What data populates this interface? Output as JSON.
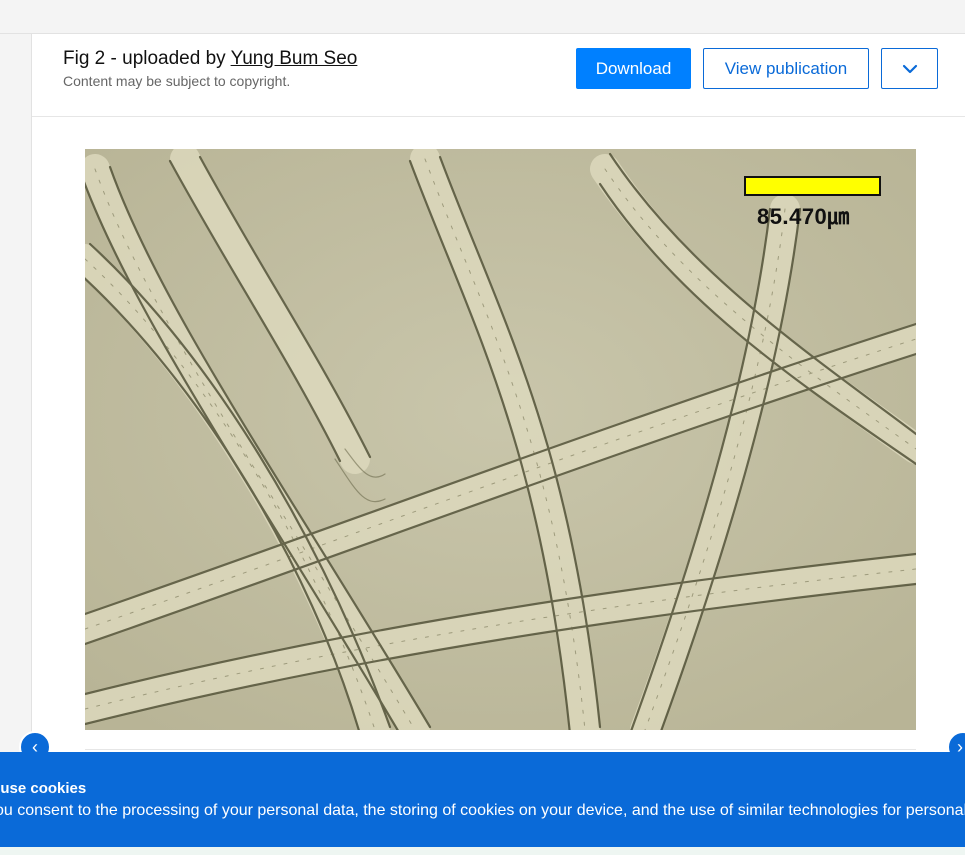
{
  "header": {
    "title_prefix": "Fig 2 - uploaded by ",
    "author": "Yung Bum Seo",
    "copyright_note": "Content may be subject to copyright."
  },
  "actions": {
    "download_label": "Download",
    "view_publication_label": "View publication"
  },
  "figure": {
    "scale_label": "85.470㎛"
  },
  "navigation": {
    "prev_glyph": "‹",
    "next_glyph": "›"
  },
  "cookie_banner": {
    "title": "rs use cookies",
    "text": "ou consent to the processing of your personal data, the storing of cookies on your device, and the use of similar technologies for personal"
  },
  "colors": {
    "primary": "#0080ff",
    "outline": "#0a6ad8",
    "banner": "#0a6ad8",
    "scale_bar": "#ffff00"
  }
}
